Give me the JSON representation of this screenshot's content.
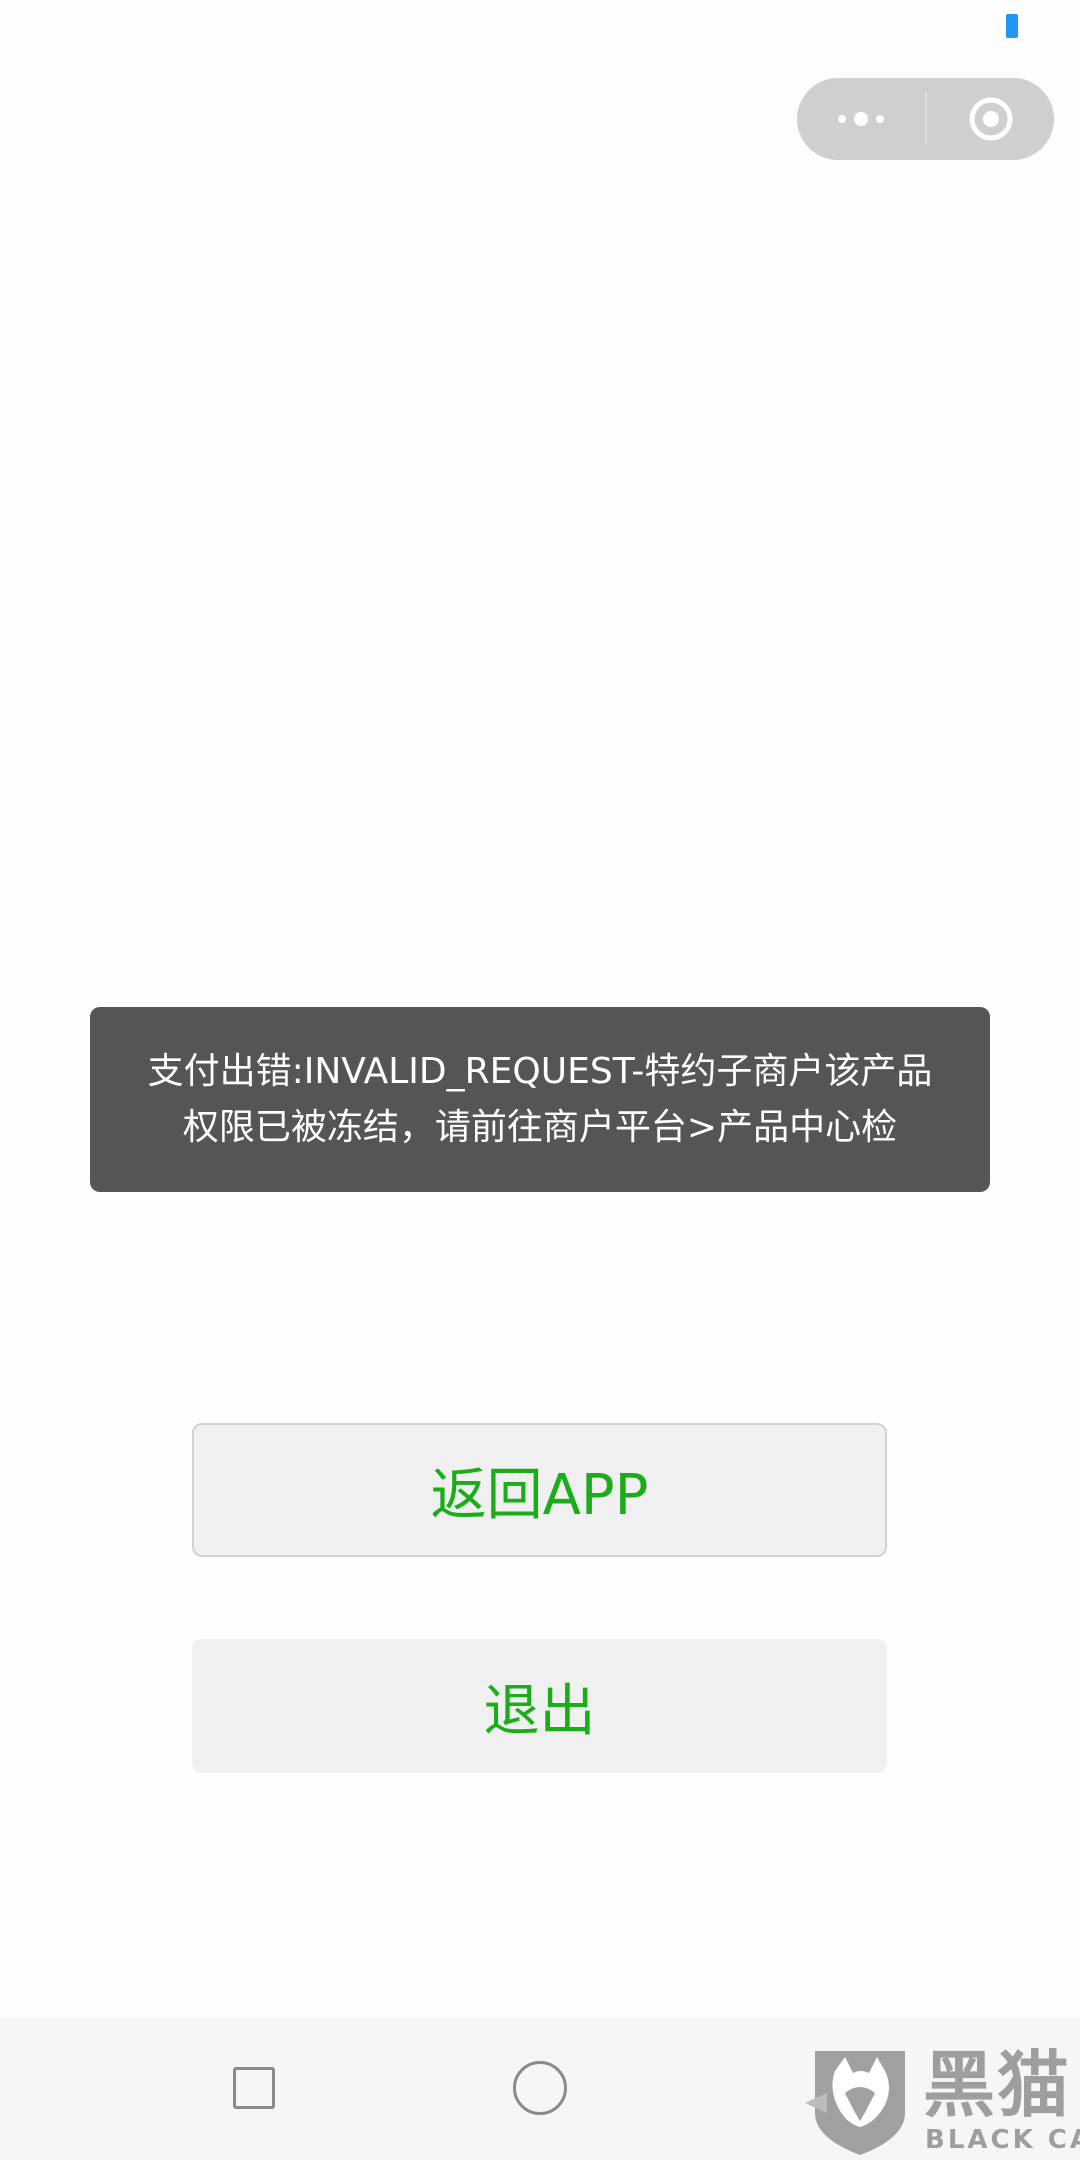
{
  "toast": {
    "message": "支付出错:INVALID_REQUEST-特约子商户该产品权限已被冻结，请前往商户平台>产品中心检"
  },
  "buttons": {
    "return_label": "返回APP",
    "exit_label": "退出"
  },
  "watermark": {
    "cn": "黑猫",
    "en": "BLACK CAT"
  },
  "colors": {
    "button_text": "#1aad19",
    "toast_bg": "#555555",
    "status_indicator": "#2196f3"
  },
  "icons": {
    "capsule_menu": "more-dots-icon",
    "capsule_close": "target-circle-icon",
    "nav_recent": "square-recent-apps-icon",
    "nav_home": "circle-home-icon",
    "watermark_logo": "black-cat-shield-logo"
  }
}
